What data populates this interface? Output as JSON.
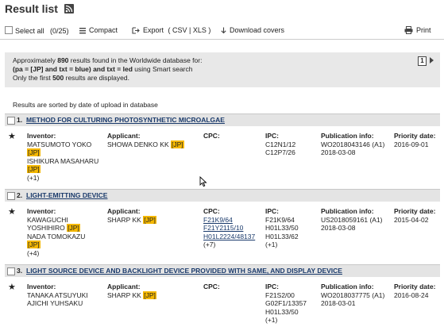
{
  "header": {
    "title": "Result list"
  },
  "toolbar": {
    "select_all": "Select all",
    "select_count": "(0/25)",
    "compact": "Compact",
    "export": "Export",
    "export_formats": "( CSV | XLS )",
    "download_covers": "Download covers",
    "print": "Print"
  },
  "info": {
    "line1_pre": "Approximately ",
    "count": "890",
    "line1_post": " results found in the Worldwide database for:",
    "query": "(pa = [JP] and txt = blue) and txt = led",
    "query_post": " using Smart search",
    "line3_pre": "Only the first ",
    "limit": "500",
    "line3_post": " results are displayed.",
    "page": "1"
  },
  "sorted_text": "Results are sorted by date of upload in database",
  "labels": {
    "inventor": "Inventor:",
    "applicant": "Applicant:",
    "cpc": "CPC:",
    "ipc": "IPC:",
    "pubinfo": "Publication info:",
    "priority": "Priority date:",
    "jp": "[JP]"
  },
  "results": [
    {
      "num": "1.",
      "title": "METHOD FOR CULTURING PHOTOSYNTHETIC MICROALGAE",
      "inventor1": "MATSUMOTO YOKO",
      "inventor2": "ISHIKURA MASAHARU",
      "inventor_more": "(+1)",
      "applicant": "SHOWA DENKO KK",
      "ipc": [
        "C12N1/12",
        "C12P7/26"
      ],
      "pub_number": "WO2018043146 (A1)",
      "pub_date": "2018-03-08",
      "priority": "2016-09-01"
    },
    {
      "num": "2.",
      "title": "LIGHT-EMITTING DEVICE",
      "inventor1": "KAWAGUCHI",
      "inventor2": "YOSHIHIRO",
      "inventor3": "NADA TOMOKAZU",
      "inventor_more": "(+4)",
      "applicant": "SHARP KK",
      "cpc": [
        "F21K9/64",
        "F21Y2115/10",
        "H01L2224/48137"
      ],
      "cpc_more": "(+7)",
      "ipc": [
        "F21K9/64",
        "H01L33/50",
        "H01L33/62"
      ],
      "ipc_more": "(+1)",
      "pub_number": "US2018059161 (A1)",
      "pub_date": "2018-03-08",
      "priority": "2015-04-02"
    },
    {
      "num": "3.",
      "title": "LIGHT SOURCE DEVICE AND BACKLIGHT DEVICE PROVIDED WITH SAME, AND DISPLAY DEVICE",
      "inventor1": "TANAKA ATSUYUKI",
      "inventor2": "AJICHI YUHSAKU",
      "applicant": "SHARP KK",
      "ipc": [
        "F21S2/00",
        "G02F1/13357",
        "H01L33/50"
      ],
      "ipc_more": "(+1)",
      "pub_number": "WO2018037775 (A1)",
      "pub_date": "2018-03-01",
      "priority": "2016-08-24"
    }
  ]
}
